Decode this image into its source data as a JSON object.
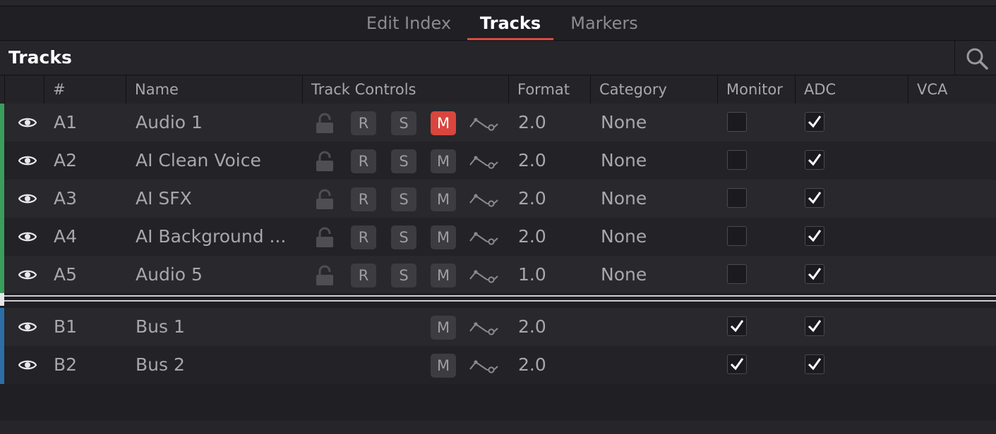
{
  "tabs": {
    "edit_index": "Edit Index",
    "tracks": "Tracks",
    "markers": "Markers"
  },
  "panel": {
    "title": "Tracks"
  },
  "columns": {
    "num": "#",
    "name": "Name",
    "controls": "Track Controls",
    "format": "Format",
    "category": "Category",
    "monitor": "Monitor",
    "adc": "ADC",
    "vca": "VCA"
  },
  "buttons": {
    "record": "R",
    "solo": "S",
    "mute": "M"
  },
  "audio_tracks": [
    {
      "id": "A1",
      "name": "Audio 1",
      "format": "2.0",
      "category": "None",
      "muted": true,
      "monitor": false,
      "adc": true
    },
    {
      "id": "A2",
      "name": "AI Clean Voice",
      "format": "2.0",
      "category": "None",
      "muted": false,
      "monitor": false,
      "adc": true
    },
    {
      "id": "A3",
      "name": "AI SFX",
      "format": "2.0",
      "category": "None",
      "muted": false,
      "monitor": false,
      "adc": true
    },
    {
      "id": "A4",
      "name": "AI Background ...",
      "format": "2.0",
      "category": "None",
      "muted": false,
      "monitor": false,
      "adc": true
    },
    {
      "id": "A5",
      "name": "Audio 5",
      "format": "1.0",
      "category": "None",
      "muted": false,
      "monitor": false,
      "adc": true
    }
  ],
  "bus_tracks": [
    {
      "id": "B1",
      "name": "Bus 1",
      "format": "2.0",
      "muted": false,
      "monitor": true,
      "adc": true
    },
    {
      "id": "B2",
      "name": "Bus 2",
      "format": "2.0",
      "muted": false,
      "monitor": true,
      "adc": true
    }
  ],
  "colors": {
    "accent": "#d9463d",
    "audio_strip": "#3a9e5c",
    "bus_strip": "#2b6fa6"
  },
  "icons": {
    "visibility": "eye-icon",
    "lock": "lock-icon",
    "automation": "automation-curve-icon",
    "search": "search-icon",
    "check": "checkmark-icon"
  }
}
